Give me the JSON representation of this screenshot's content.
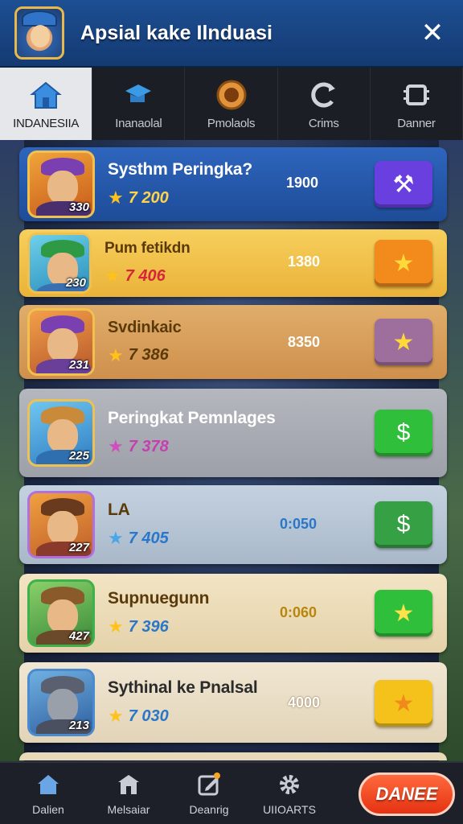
{
  "header": {
    "title": "Apsial kake Ilnduasi",
    "close_glyph": "✕",
    "avatar_icon": "hero-avatar-icon"
  },
  "tabs": [
    {
      "label": "INDANESIIA",
      "icon": "home-icon",
      "active": true
    },
    {
      "label": "Inanaolal",
      "icon": "hat-icon",
      "active": false
    },
    {
      "label": "Pmolaols",
      "icon": "badge-icon",
      "active": false
    },
    {
      "label": "Crims",
      "icon": "refresh-icon",
      "active": false
    },
    {
      "label": "Danner",
      "icon": "chip-icon",
      "active": false
    }
  ],
  "rows": [
    {
      "name": "Systhm Peringka?",
      "stars": "7 200",
      "score": "1900",
      "level": "330",
      "action_glyph": "⚒",
      "bg": "#2557a7",
      "btn": "#6a3fe0",
      "name_color": "#ffffff",
      "stars_color": "#ffd34a",
      "score_color": "#ffffff"
    },
    {
      "name": "Pum fetikdn",
      "stars": "7 406",
      "score": "1380",
      "level": "230",
      "action_glyph": "★",
      "bg": "#f2c04a",
      "btn": "#f28a1c",
      "name_color": "#5a3a0a",
      "stars_color": "#d6263a",
      "score_color": "#ffffff"
    },
    {
      "name": "Svdinkaic",
      "stars": "7 386",
      "score": "8350",
      "level": "231",
      "action_glyph": "★",
      "bg": "#d9a15c",
      "btn": "#9e6f9c",
      "name_color": "#5a3a0a",
      "stars_color": "#5a3a0a",
      "score_color": "#ffffff"
    },
    {
      "name": "Peringkat Pemnlages",
      "stars": "7 378",
      "score": "",
      "level": "225",
      "action_glyph": "$",
      "bg": "#a9acb3",
      "btn": "#2fbf3a",
      "name_color": "#ffffff",
      "stars_color": "#c63fb0",
      "score_color": "#ffffff"
    },
    {
      "name": "LA",
      "stars": "7 405",
      "score": "0:050",
      "level": "227",
      "action_glyph": "$",
      "bg": "#b8c6d6",
      "btn": "#36a144",
      "name_color": "#5a3a0a",
      "stars_color": "#2a77c9",
      "score_color": "#2a77c9"
    },
    {
      "name": "Supnuegunn",
      "stars": "7 396",
      "score": "0:060",
      "level": "427",
      "action_glyph": "★",
      "bg": "#ecdcb8",
      "btn": "#2fbf3a",
      "name_color": "#5a3a0a",
      "stars_color": "#2a77c9",
      "score_color": "#b8860b"
    },
    {
      "name": "Sythinal ke Pnalsal",
      "stars": "7 030",
      "score": "4000",
      "level": "213",
      "action_glyph": "★",
      "bg": "#e9dfca",
      "btn": "#f5c21b",
      "name_color": "#2b2b2b",
      "stars_color": "#2a77c9",
      "score_color": "#ffffff"
    }
  ],
  "bottom_nav": [
    {
      "label": "Dalien",
      "icon": "home-icon"
    },
    {
      "label": "Melsaiar",
      "icon": "store-icon"
    },
    {
      "label": "Deanrig",
      "icon": "edit-icon"
    },
    {
      "label": "UIIOARTS",
      "icon": "gear-icon"
    }
  ],
  "cta_label": "DANEE"
}
